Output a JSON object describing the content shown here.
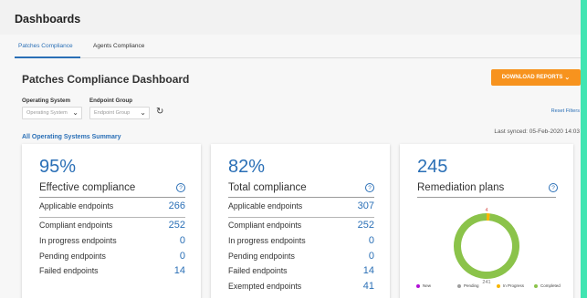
{
  "page_title": "Dashboards",
  "tabs": [
    {
      "label": "Patches Compliance",
      "active": true
    },
    {
      "label": "Agents Compliance",
      "active": false
    }
  ],
  "dashboard_title": "Patches Compliance Dashboard",
  "download_button": "DOWNLOAD REPORTS",
  "filters": {
    "os_label": "Operating System",
    "os_value": "Operating System",
    "group_label": "Endpoint Group",
    "group_value": "Endpoint Group",
    "reset_label": "Reset Filters"
  },
  "summary_link": "All Operating Systems Summary",
  "last_synced": "Last synced: 05-Feb-2020 14:03",
  "cards": [
    {
      "big": "95%",
      "subtitle": "Effective compliance",
      "rows": [
        {
          "label": "Applicable endpoints",
          "value": "266"
        },
        {
          "label": "Compliant endpoints",
          "value": "252"
        },
        {
          "label": "In progress endpoints",
          "value": "0"
        },
        {
          "label": "Pending endpoints",
          "value": "0"
        },
        {
          "label": "Failed endpoints",
          "value": "14"
        }
      ]
    },
    {
      "big": "82%",
      "subtitle": "Total compliance",
      "rows": [
        {
          "label": "Applicable endpoints",
          "value": "307"
        },
        {
          "label": "Compliant endpoints",
          "value": "252"
        },
        {
          "label": "In progress endpoints",
          "value": "0"
        },
        {
          "label": "Pending endpoints",
          "value": "0"
        },
        {
          "label": "Failed endpoints",
          "value": "14"
        },
        {
          "label": "Exempted endpoints",
          "value": "41"
        }
      ]
    },
    {
      "big": "245",
      "subtitle": "Remediation plans"
    }
  ],
  "chart_data": {
    "type": "pie",
    "donut": true,
    "categories": [
      "New",
      "Pending",
      "In Progress",
      "Completed"
    ],
    "values": [
      0,
      0,
      4,
      241
    ],
    "colors": [
      "#b10fd6",
      "#9e9e9e",
      "#f7b500",
      "#8bc34a"
    ],
    "slice_labels": [
      "",
      "",
      "4",
      "241"
    ]
  },
  "colors": {
    "accent": "#2a6fb6",
    "download": "#f7931e",
    "strip": "#41e5b2"
  },
  "icons": {
    "refresh": "refresh-icon",
    "help": "help-icon",
    "chevron": "chevron-down-icon"
  }
}
